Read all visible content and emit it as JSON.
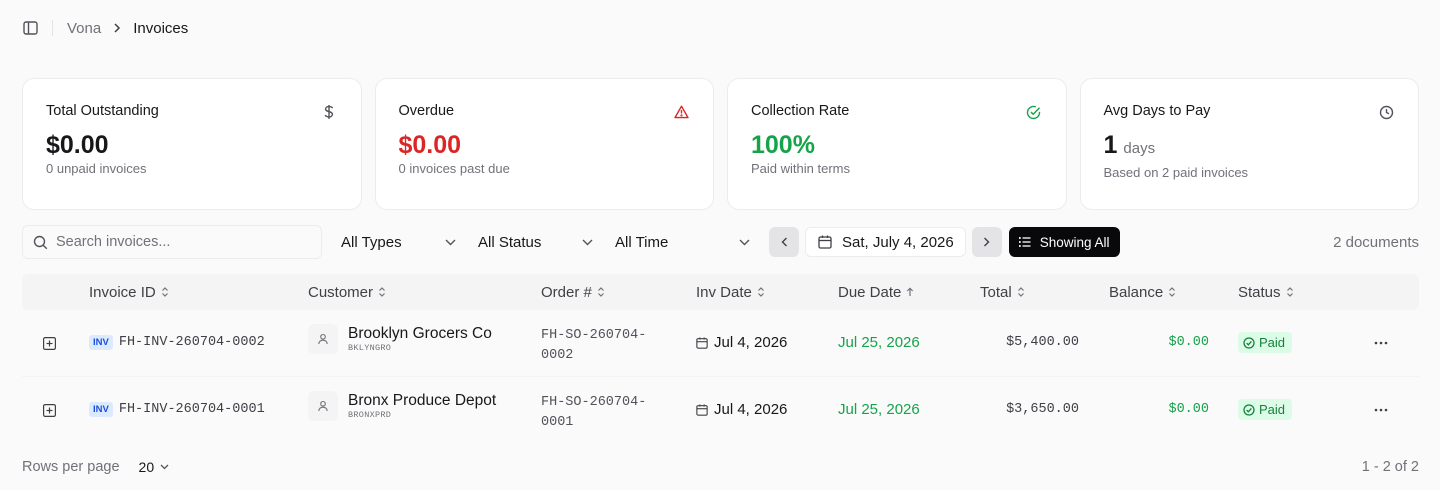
{
  "breadcrumb": {
    "root": "Vona",
    "current": "Invoices"
  },
  "cards": [
    {
      "title": "Total Outstanding",
      "value": "$0.00",
      "unit": "",
      "sub": "0 unpaid invoices",
      "icon": "dollar-icon"
    },
    {
      "title": "Overdue",
      "value": "$0.00",
      "unit": "",
      "sub": "0 invoices past due",
      "icon": "alert-triangle-icon",
      "accent": "#dc2626"
    },
    {
      "title": "Collection Rate",
      "value": "100%",
      "unit": "",
      "sub": "Paid within terms",
      "icon": "check-circle-icon",
      "accent": "#16a34a"
    },
    {
      "title": "Avg Days to Pay",
      "value": "1",
      "unit": "days",
      "sub": "Based on 2 paid invoices",
      "icon": "clock-icon"
    }
  ],
  "toolbar": {
    "search_placeholder": "Search invoices...",
    "type_filter": "All Types",
    "status_filter": "All Status",
    "time_filter": "All Time",
    "date": "Sat, July 4, 2026",
    "showing_all": "Showing All",
    "doc_count": "2 documents"
  },
  "table": {
    "headers": {
      "invoice_id": "Invoice ID",
      "customer": "Customer",
      "order": "Order #",
      "inv_date": "Inv Date",
      "due_date": "Due Date",
      "total": "Total",
      "balance": "Balance",
      "status": "Status"
    },
    "rows": [
      {
        "badge": "INV",
        "invoice_id": "FH-INV-260704-0002",
        "customer_name": "Brooklyn Grocers Co",
        "customer_code": "BKLYNGRO",
        "order_line1": "FH-SO-260704-",
        "order_line2": "0002",
        "inv_date": "Jul 4, 2026",
        "due_date": "Jul 25, 2026",
        "total": "$5,400.00",
        "balance": "$0.00",
        "status": "Paid"
      },
      {
        "badge": "INV",
        "invoice_id": "FH-INV-260704-0001",
        "customer_name": "Bronx Produce Depot",
        "customer_code": "BRONXPRD",
        "order_line1": "FH-SO-260704-",
        "order_line2": "0001",
        "inv_date": "Jul 4, 2026",
        "due_date": "Jul 25, 2026",
        "total": "$3,650.00",
        "balance": "$0.00",
        "status": "Paid"
      }
    ]
  },
  "footer": {
    "rows_label": "Rows per page",
    "rows_value": "20",
    "page_info": "1 - 2 of 2"
  },
  "colors": {
    "danger": "#dc2626",
    "success": "#16a34a",
    "dark": "#09090b",
    "inv_badge": "#dbeafe"
  }
}
